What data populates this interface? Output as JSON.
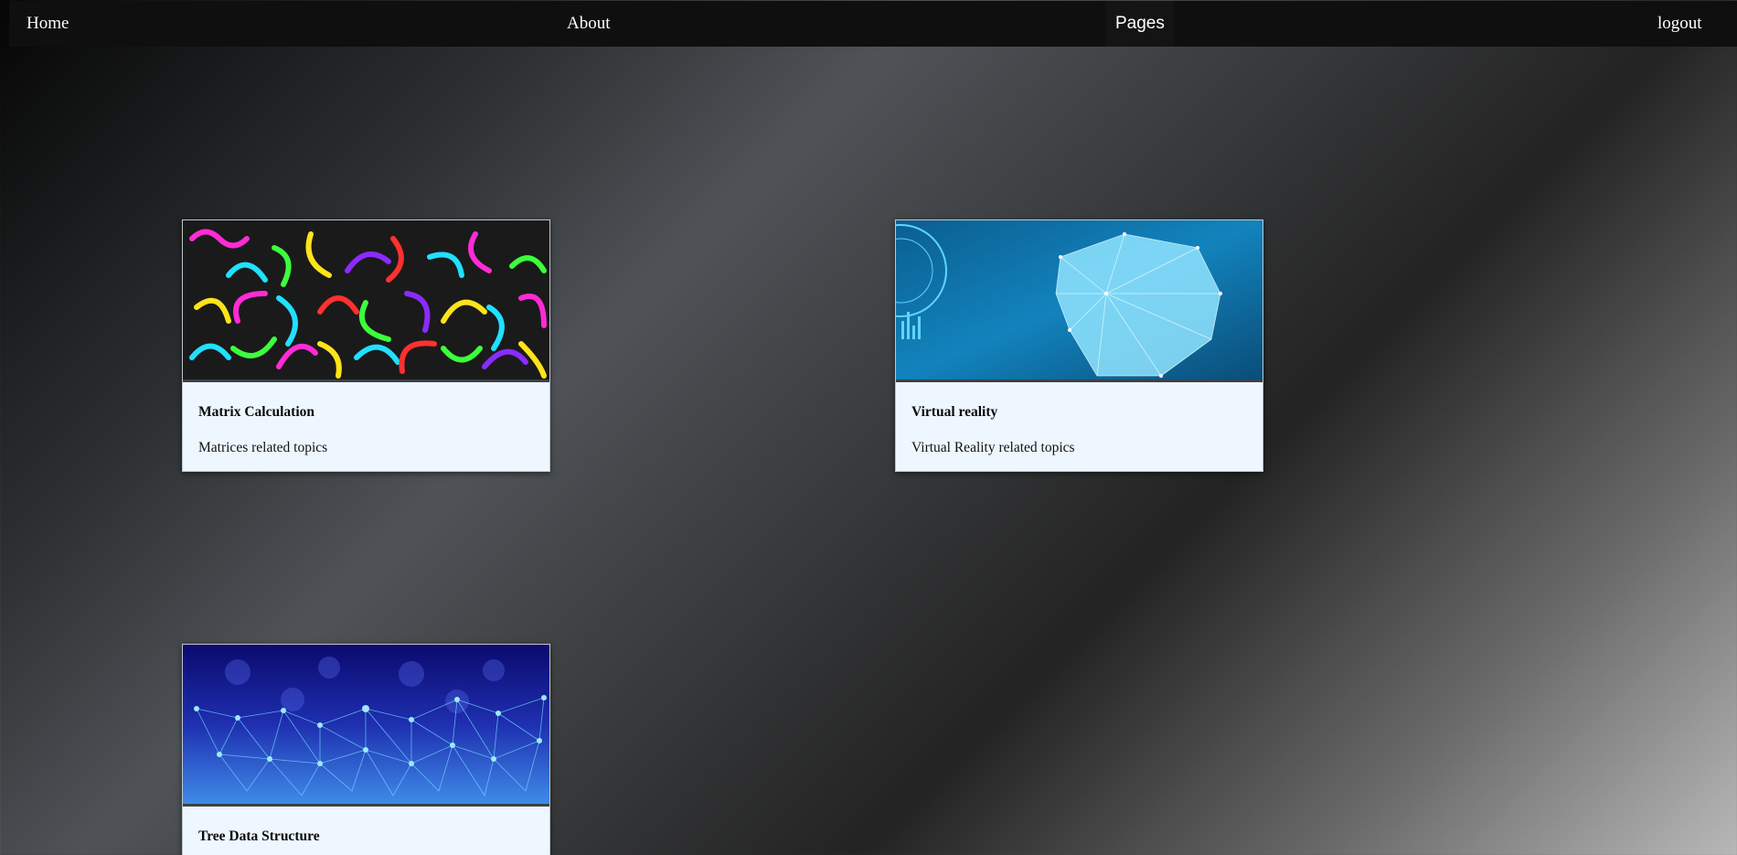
{
  "nav": {
    "home": "Home",
    "about": "About",
    "pages": "Pages",
    "logout": "logout"
  },
  "cards": [
    {
      "title": "Matrix Calculation",
      "description": "Matrices related topics",
      "image": "colorful-numbers-image"
    },
    {
      "title": "Virtual reality",
      "description": "Virtual Reality related topics",
      "image": "vr-headset-wireframe-image"
    },
    {
      "title": "Tree Data Structure",
      "description": "",
      "image": "network-nodes-image"
    }
  ],
  "colors": {
    "navbar": "#0f0f10",
    "card_background": "#eef7ff",
    "nav_text": "#ffffff"
  }
}
